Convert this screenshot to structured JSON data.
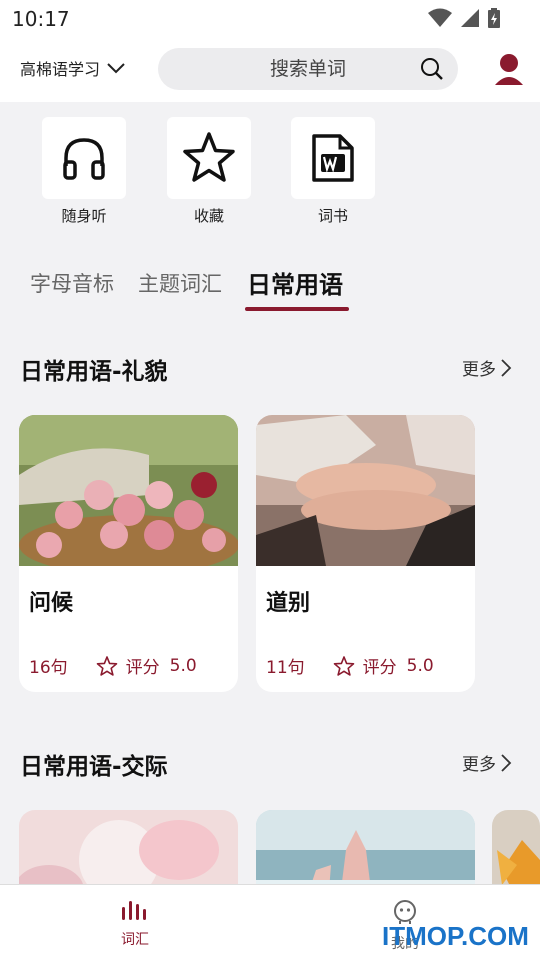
{
  "status": {
    "time": "10:17"
  },
  "header": {
    "language": "高棉语学习",
    "search_placeholder": "搜索单词"
  },
  "quick_actions": [
    {
      "label": "随身听",
      "icon": "headphones-icon"
    },
    {
      "label": "收藏",
      "icon": "star-icon"
    },
    {
      "label": "词书",
      "icon": "word-doc-icon"
    }
  ],
  "tabs": [
    {
      "label": "字母音标",
      "active": false
    },
    {
      "label": "主题词汇",
      "active": false
    },
    {
      "label": "日常用语",
      "active": true
    }
  ],
  "sections": [
    {
      "title": "日常用语-礼貌",
      "more": "更多",
      "cards": [
        {
          "title": "问候",
          "count": "16句",
          "rating_label": "评分",
          "rating": "5.0",
          "image": "roses-basket-photo"
        },
        {
          "title": "道别",
          "count": "11句",
          "rating_label": "评分",
          "rating": "5.0",
          "image": "stacked-hands-photo"
        }
      ]
    },
    {
      "title": "日常用语-交际",
      "more": "更多",
      "cards": [
        {
          "image": "pink-flower-photo"
        },
        {
          "image": "raised-hands-photo"
        },
        {
          "image": "orange-flower-photo"
        }
      ]
    }
  ],
  "bottom_nav": [
    {
      "label": "词汇",
      "icon": "bars-chart-icon",
      "active": true
    },
    {
      "label": "我的",
      "icon": "robot-face-icon",
      "active": false
    }
  ],
  "watermark": "ITMOP.COM",
  "colors": {
    "accent": "#8a1a2e",
    "background": "#f2f2f4"
  }
}
